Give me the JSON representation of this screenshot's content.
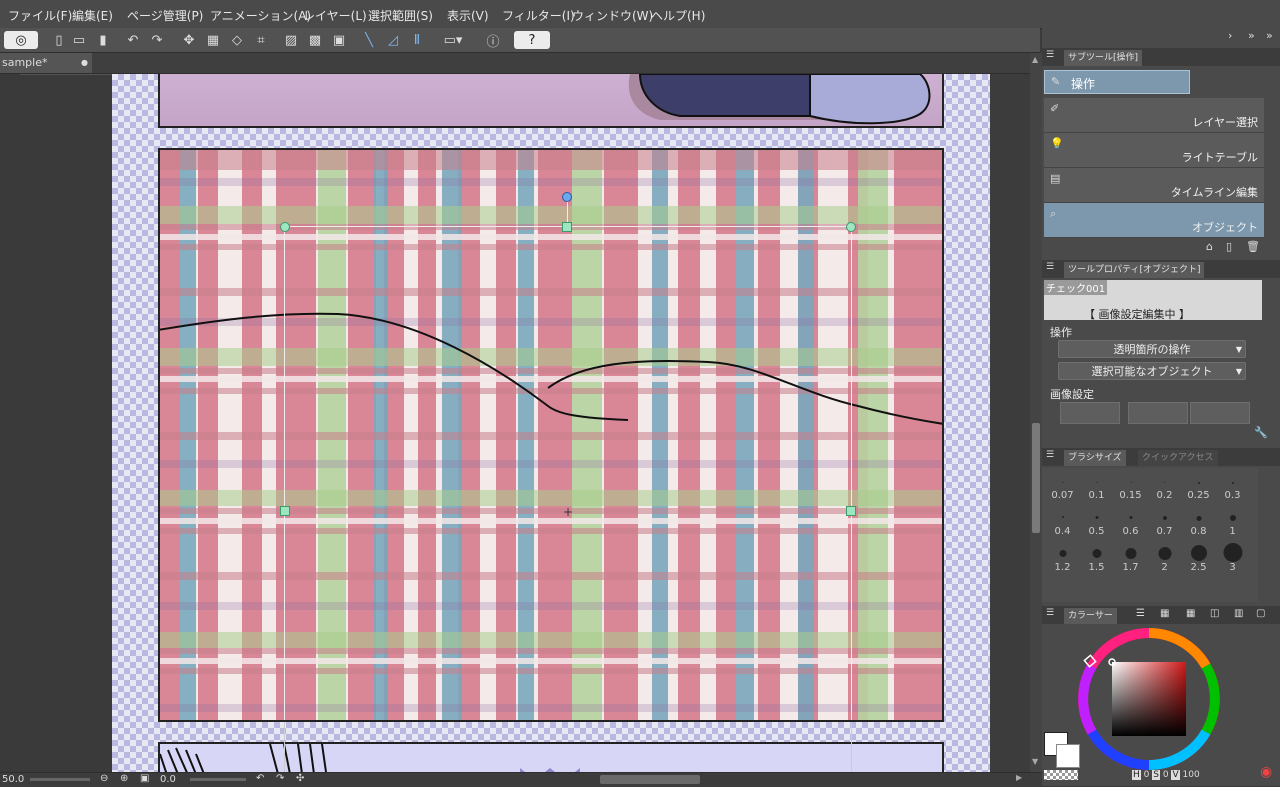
{
  "menu": [
    "ファイル(F)",
    "編集(E)",
    "ページ管理(P)",
    "アニメーション(A)",
    "レイヤー(L)",
    "選択範囲(S)",
    "表示(V)",
    "フィルター(I)",
    "ウィンドウ(W)",
    "ヘルプ(H)"
  ],
  "document": {
    "tab_name": "sample*",
    "zoom": "50.0",
    "angle": "0.0"
  },
  "subtool_panel": {
    "tab": "サブツール[操作]",
    "group_button": "操作",
    "items": [
      "レイヤー選択",
      "ライトテーブル",
      "タイムライン編集",
      "オブジェクト"
    ],
    "selected": "オブジェクト"
  },
  "tool_property": {
    "tab": "ツールプロパティ[オブジェクト]",
    "object_name": "チェック001",
    "status": "【 画像設定編集中 】",
    "section_operation": "操作",
    "dropdown1": "透明箇所の操作",
    "dropdown2": "選択可能なオブジェクト",
    "section_image": "画像設定"
  },
  "brush_size": {
    "tab": "ブラシサイズ",
    "tab2": "クイックアクセス",
    "sizes": [
      "0.07",
      "0.1",
      "0.15",
      "0.2",
      "0.25",
      "0.3",
      "0.4",
      "0.5",
      "0.6",
      "0.7",
      "0.8",
      "1",
      "1.2",
      "1.5",
      "1.7",
      "2",
      "2.5",
      "3"
    ]
  },
  "color": {
    "tab": "カラーサー",
    "main_color": "#ffffff",
    "hue_selected": "#cc1a1a",
    "status": {
      "h_label": "H",
      "h_value": "0",
      "s_label": "S",
      "s_value": "0",
      "v_label": "V",
      "v_value": "100"
    }
  }
}
